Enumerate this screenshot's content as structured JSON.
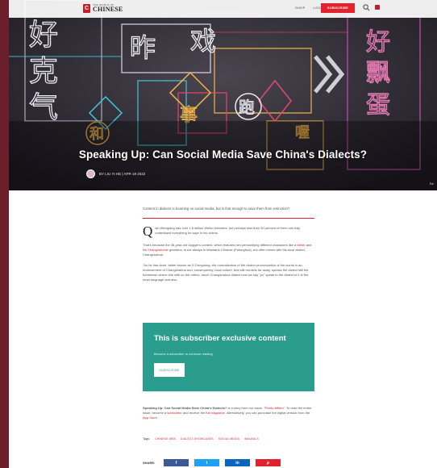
{
  "brand": {
    "small_text": "THE WORLD OF",
    "name": "CHINESE",
    "accent": "#e0232f",
    "teal": "#2a9d8f"
  },
  "nav": {
    "items": [
      "SHOP",
      "LOGIN"
    ],
    "subscribe_label": "SUBSCRIBE",
    "search_icon": "search-icon",
    "user_icon": "user-icon"
  },
  "hero": {
    "neon_glyphs": [
      "好",
      "克",
      "气",
      "昨",
      "戏",
      "好",
      "飘",
      "蛋",
      "和",
      "跑",
      "事",
      "喔"
    ],
    "title": "Speaking Up: Can Social Media Save China's Dialects?",
    "byline": "BY LIU YI HE  |  APR 18 2022",
    "credit": "Rdl"
  },
  "article": {
    "standfirst": "Content in dialects is booming on social media, but is that enough to save them from extinction?",
    "dropcap": "Q",
    "para1": "ian Wenqiang has over 1.8 million Weibo followers, but perhaps less than 30 percent of them can fully understand everything he says in his videos.",
    "para2_start": "That's because the 36-year-old vlogger's content, which features him personifying different characters like a ",
    "para2_link1": "father",
    "para2_mid": " and his ",
    "para2_link2": "Shanghainese",
    "para2_end": " grandma, is not always in Mandarin Chinese (Putonghua), but often mixed with his local dialect, Changshahua.",
    "para3": "\"As he has done, better known as G Dongdong, the normalization of the dialect pronunciation of the words is an endorsement of Changshahua and, consequently, local culture, that still remains far away, speaks the dialect still the hometown where she with so the others, much Changshahua dialect now we say \"yo\" speak to the dialect of it is\"the tonal language and also"
  },
  "paywall": {
    "title": "This is subscriber exclusive content",
    "subtitle": "Become a subscriber to continue reading",
    "button": "SUBSCRIBE"
  },
  "after": {
    "text_start": "Speaking Up: Can Social Media Save China's Dialects?",
    "text_mid1": " is a story from our issue, ",
    "text_link1": "\"Public Affairs\"",
    "text_mid2": ". To read the entire issue, become a ",
    "text_link2": "subscriber",
    "text_mid3": " and receive the ",
    "text_link3": "full magazine",
    "text_mid4": ". Alternatively, you can purchase the digital version from the ",
    "text_link4": "App Store",
    "text_end": "."
  },
  "tags": {
    "label": "Tags:",
    "items": [
      "CHINESE WEB",
      "DIALECT SHOWCASES",
      "SOCIAL MEDIA",
      "WALWALS"
    ]
  },
  "share": {
    "label": "SHARE:",
    "buttons": [
      "f",
      "t",
      "in",
      "p"
    ]
  }
}
